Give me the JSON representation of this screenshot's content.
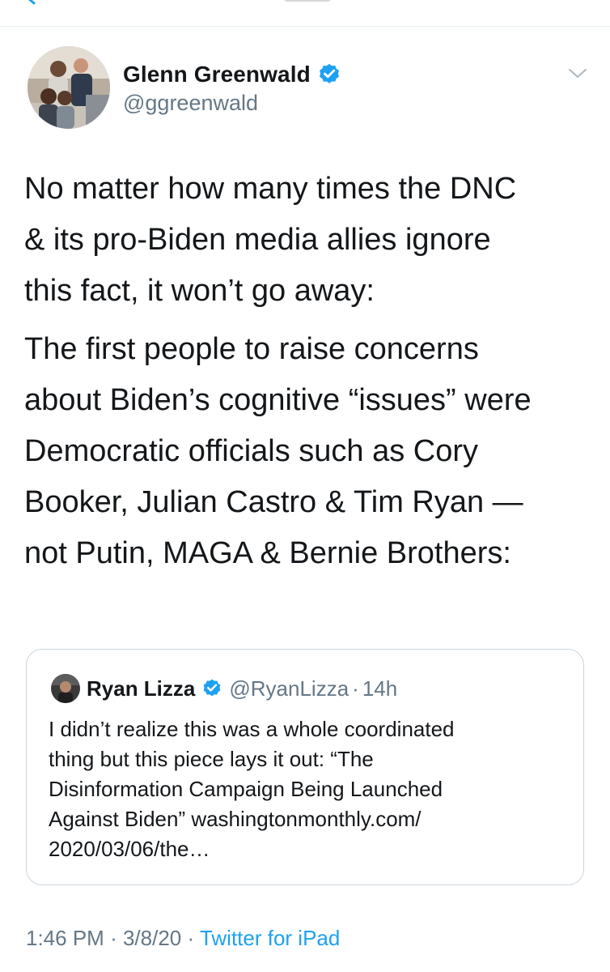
{
  "tweet": {
    "author": {
      "display_name": "Glenn Greenwald",
      "handle": "@ggreenwald",
      "verified": true
    },
    "text_paragraphs": [
      [
        "No matter how many times the DNC",
        "& its pro-Biden media allies ignore",
        "this fact, it won’t go away:"
      ],
      [
        "The first people to raise concerns",
        "about Biden’s cognitive “issues” were",
        "Democratic officials such as Cory",
        "Booker, Julian Castro & Tim Ryan —",
        "not Putin, MAGA & Bernie Brothers:"
      ]
    ],
    "time": "1:46 PM",
    "date": "3/8/20",
    "separator": "·",
    "source": "Twitter for iPad"
  },
  "quoted_tweet": {
    "display_name": "Ryan Lizza",
    "handle": "@RyanLizza",
    "separator": "·",
    "age": "14h",
    "verified": true,
    "text_lines": [
      "I didn’t realize this was a whole coordinated",
      "thing but this piece lays it out: “The",
      "Disinformation Campaign Being Launched",
      "Against Biden” washingtonmonthly.com/",
      "2020/03/06/the…"
    ]
  },
  "icons": {
    "back": "back-arrow-icon",
    "verified": "verified-badge-icon",
    "more": "chevron-down-icon"
  },
  "colors": {
    "text": "#14171a",
    "secondary": "#657786",
    "link": "#1da1f2",
    "verified": "#1da1f2",
    "border": "#ccd6dd"
  }
}
